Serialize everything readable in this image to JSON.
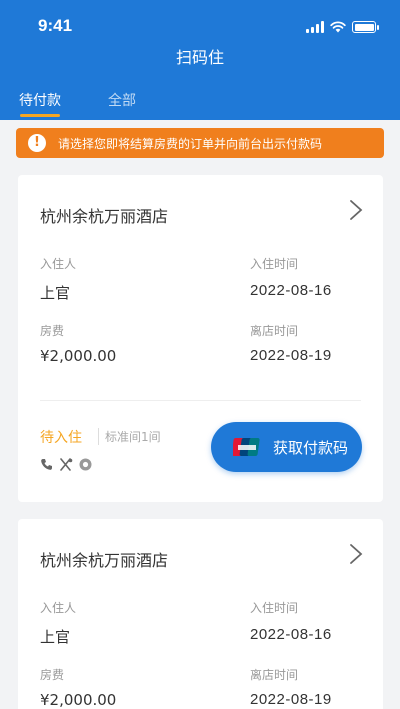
{
  "status_bar": {
    "time": "9:41"
  },
  "header": {
    "title": "扫码住"
  },
  "tabs": [
    {
      "label": "待付款",
      "active": true
    },
    {
      "label": "全部",
      "active": false
    }
  ],
  "notice": {
    "text": "请选择您即将结算房费的订单并向前台出示付款码",
    "color": "#f07f1d"
  },
  "orders": [
    {
      "hotel_name": "杭州余杭万丽酒店",
      "guest_label": "入住人",
      "guest_value": "上官",
      "checkin_label": "入住时间",
      "checkin_value": "2022-08-16",
      "fee_label": "房费",
      "fee_value": "¥2,000.00",
      "checkout_label": "离店时间",
      "checkout_value": "2022-08-19",
      "status": "待入住",
      "room_type": "标准间1间",
      "amenity_icons": [
        "phone-icon",
        "dining-icon",
        "chat-icon"
      ],
      "pay_button_label": "获取付款码"
    },
    {
      "hotel_name": "杭州余杭万丽酒店",
      "guest_label": "入住人",
      "guest_value": "上官",
      "checkin_label": "入住时间",
      "checkin_value": "2022-08-16",
      "fee_label": "房费",
      "fee_value": "¥2,000.00",
      "checkout_label": "离店时间",
      "checkout_value": "2022-08-19"
    }
  ],
  "colors": {
    "primary": "#1f79d7",
    "accent": "#f5a623",
    "notice": "#f07f1d"
  }
}
